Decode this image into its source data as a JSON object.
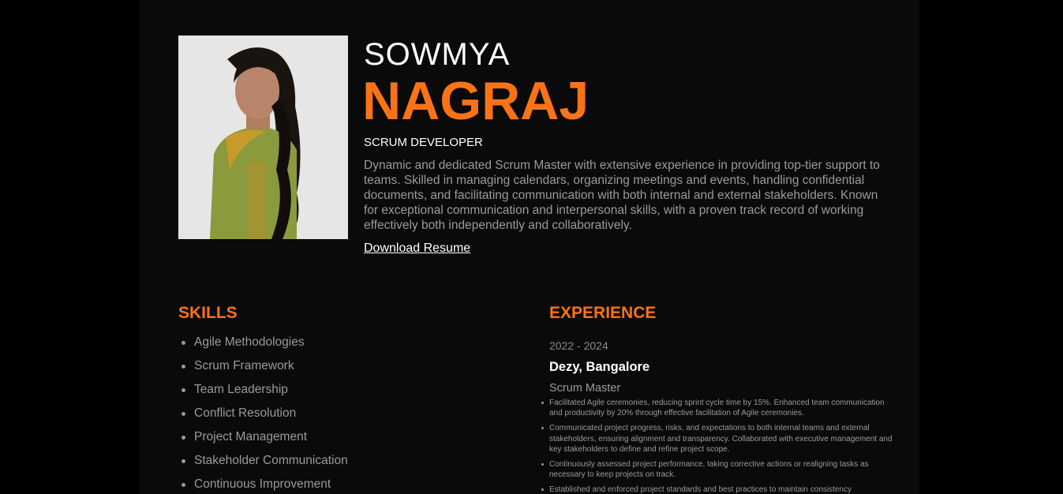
{
  "profile": {
    "first_name": "SOWMYA",
    "last_name": "NAGRAJ",
    "role": "SCRUM DEVELOPER",
    "bio": "Dynamic and dedicated Scrum Master with extensive experience in providing top-tier support to teams. Skilled in managing calendars, organizing meetings and events, handling confidential documents, and facilitating communication with both internal and external stakeholders. Known for exceptional communication and interpersonal skills, with a proven track record of working effectively both independently and collaboratively.",
    "resume_link": "Download Resume"
  },
  "skills": {
    "title": "SKILLS",
    "items": [
      "Agile Methodologies",
      "Scrum Framework",
      "Team Leadership",
      "Conflict Resolution",
      "Project Management",
      "Stakeholder Communication",
      "Continuous Improvement"
    ]
  },
  "experience": {
    "title": "EXPERIENCE",
    "entries": [
      {
        "period": "2022 - 2024",
        "company": "Dezy, Bangalore",
        "position": "Scrum Master",
        "bullets": [
          "Facilitated Agile ceremonies, reducing sprint cycle time by 15%. Enhanced team communication and productivity by 20% through effective facilitation of Agile ceremonies.",
          "Communicated project progress, risks, and expectations to both internal teams and external stakeholders, ensuring alignment and transparency. Collaborated with executive management and key stakeholders to define and refine project scope.",
          "Continuously assessed project performance, taking corrective actions or realigning tasks as necessary to keep projects on track.",
          "Established and enforced project standards and best practices to maintain consistency"
        ]
      }
    ]
  },
  "colors": {
    "accent": "#f97316",
    "background": "#0a0a0a",
    "outer_background": "#000000",
    "muted_text": "#9a9a9a"
  }
}
